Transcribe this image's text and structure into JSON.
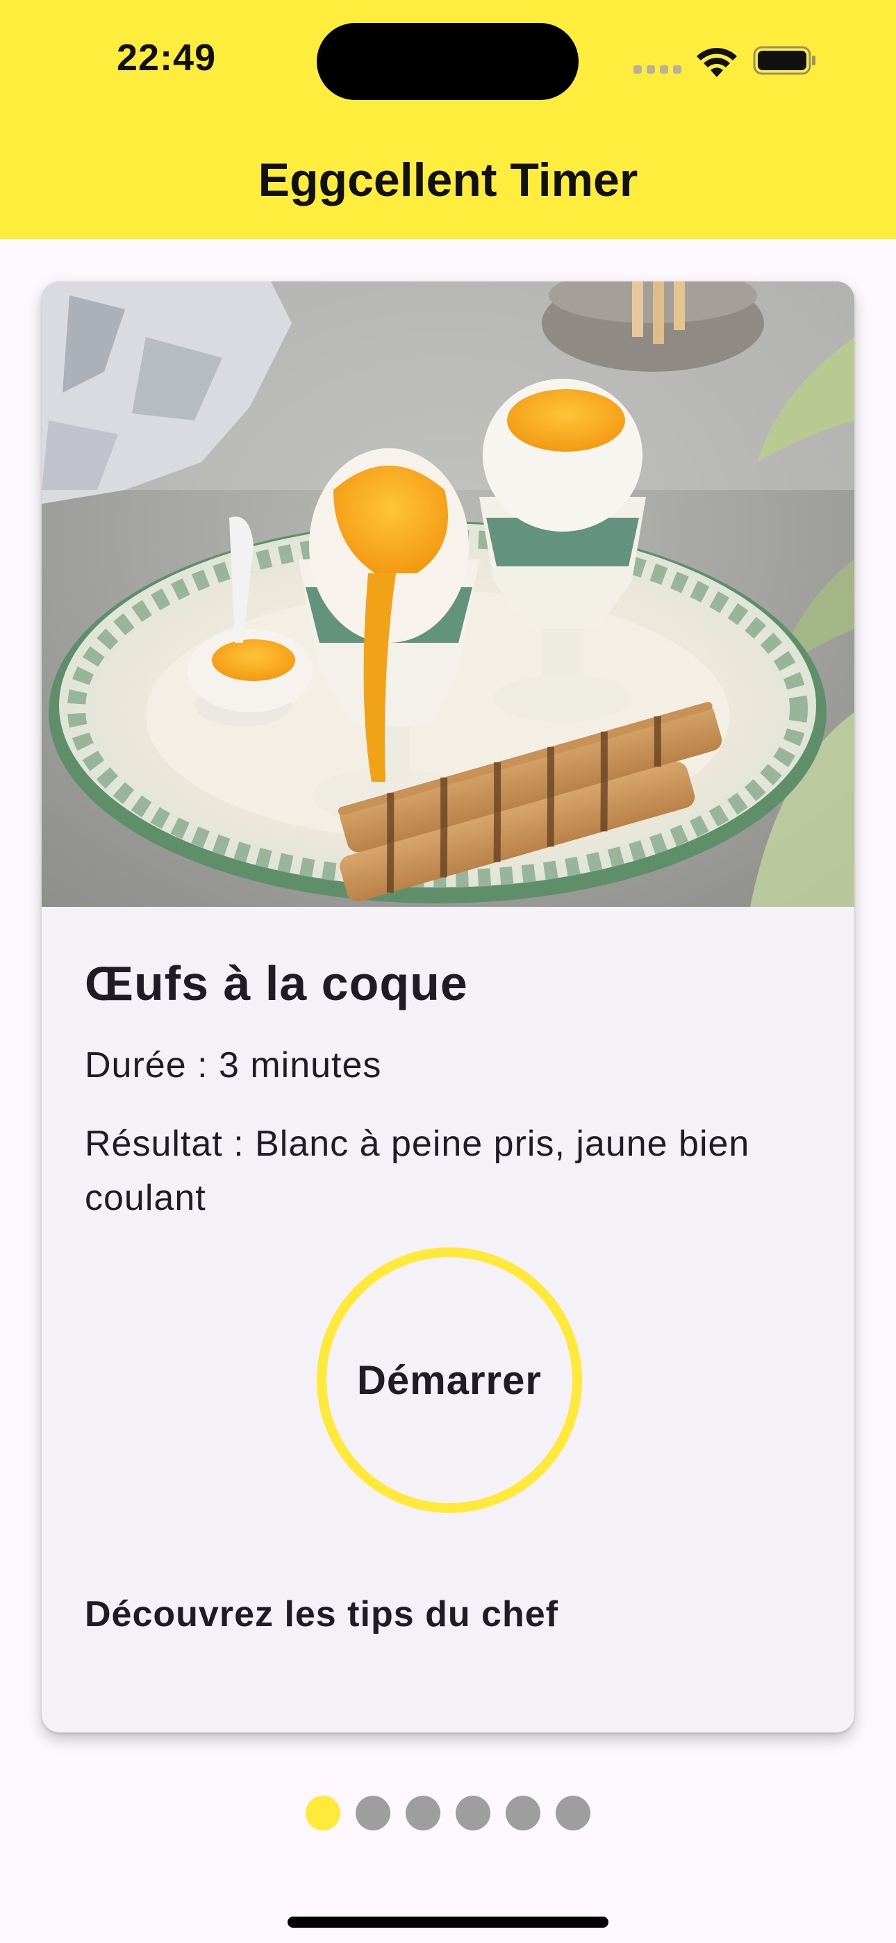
{
  "status_bar": {
    "time": "22:49",
    "icons": [
      "cellular-signal-icon",
      "wifi-icon",
      "battery-icon"
    ]
  },
  "header": {
    "title": "Eggcellent Timer"
  },
  "colors": {
    "accent": "#ffed3e",
    "background": "#fcf8fd",
    "card": "#f4f2f6",
    "inactive_dot": "#9e9e9e",
    "text": "#1f1c24"
  },
  "card": {
    "image_alt": "soft-boiled eggs with toast soldiers",
    "title": "Œufs à la coque",
    "duration": "Durée : 3 minutes",
    "result": "Résultat : Blanc à peine pris, jaune bien coulant",
    "start_label": "Démarrer",
    "tips_link": "Découvrez les tips du chef"
  },
  "pager": {
    "count": 6,
    "active_index": 0
  }
}
